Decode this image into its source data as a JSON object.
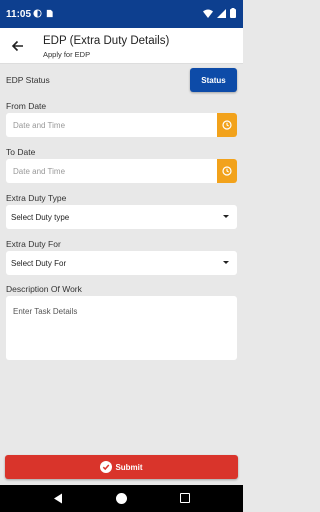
{
  "status_bar": {
    "time": "11:05"
  },
  "header": {
    "title": "EDP (Extra Duty Details)",
    "subtitle": "Apply for EDP"
  },
  "form": {
    "edp_status_label": "EDP Status",
    "status_button": "Status",
    "from_date": {
      "label": "From Date",
      "placeholder": "Date and Time"
    },
    "to_date": {
      "label": "To Date",
      "placeholder": "Date and Time"
    },
    "duty_type": {
      "label": "Extra Duty Type",
      "value": "Select Duty type"
    },
    "duty_for": {
      "label": "Extra Duty For",
      "value": "Select Duty For"
    },
    "description": {
      "label": "Description Of Work",
      "placeholder": "Enter Task Details"
    }
  },
  "footer": {
    "submit_label": "Submit"
  },
  "colors": {
    "primary": "#0d3f8f",
    "accent": "#f2a21b",
    "submit": "#d9342b"
  }
}
